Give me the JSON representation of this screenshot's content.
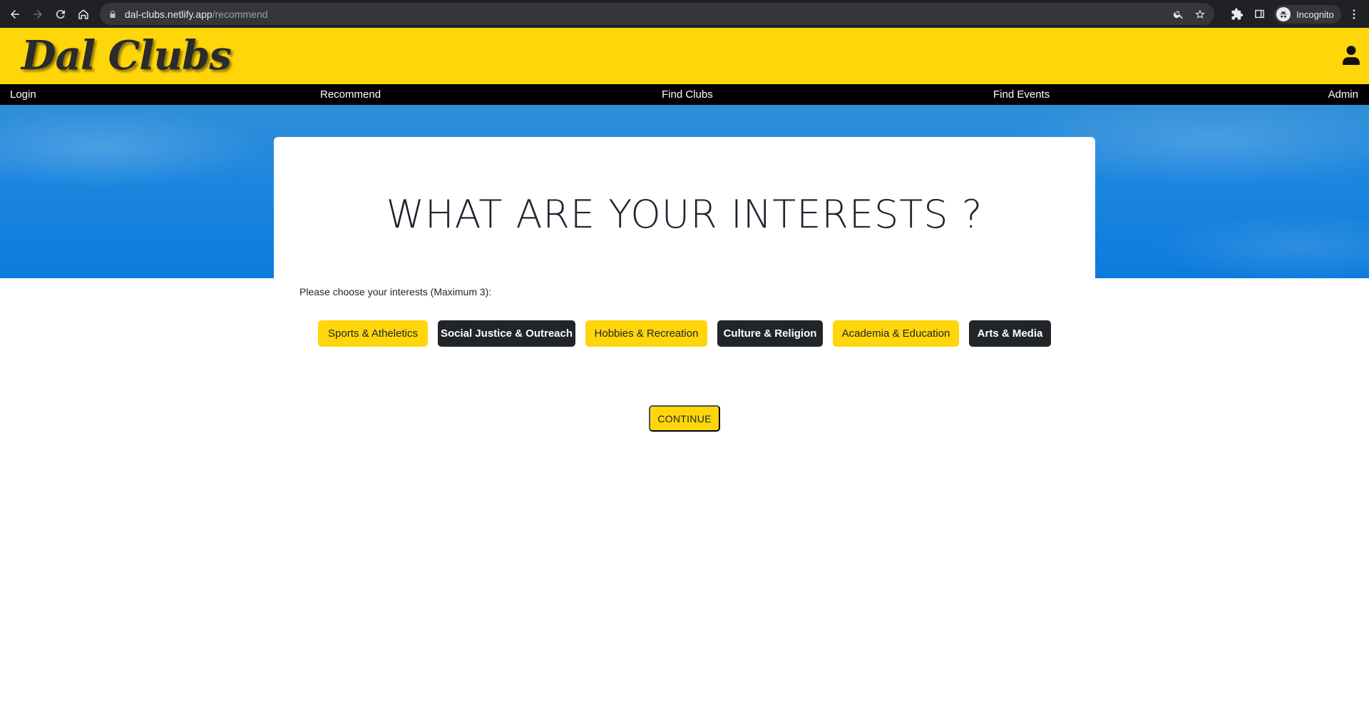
{
  "browser": {
    "url_host": "dal-clubs.netlify.app",
    "url_path": "/recommend",
    "profile_label": "Incognito"
  },
  "site": {
    "logo": "Dal Clubs",
    "nav": [
      {
        "label": "Login"
      },
      {
        "label": "Recommend"
      },
      {
        "label": "Find Clubs"
      },
      {
        "label": "Find Events"
      },
      {
        "label": "Admin"
      }
    ]
  },
  "main": {
    "title": "WHAT ARE YOUR INTERESTS ?",
    "prompt": "Please choose your interests (Maximum 3):",
    "interests": [
      {
        "label": "Sports & Atheletics",
        "style": "yellow"
      },
      {
        "label": "Social Justice & Outreach",
        "style": "dark"
      },
      {
        "label": "Hobbies & Recreation",
        "style": "yellow"
      },
      {
        "label": "Culture & Religion",
        "style": "dark"
      },
      {
        "label": "Academia & Education",
        "style": "yellow"
      },
      {
        "label": "Arts & Media",
        "style": "dark"
      }
    ],
    "continue_label": "CONTINUE"
  },
  "colors": {
    "brand_yellow": "#ffd60a",
    "dark": "#212529",
    "nav_black": "#000000"
  }
}
